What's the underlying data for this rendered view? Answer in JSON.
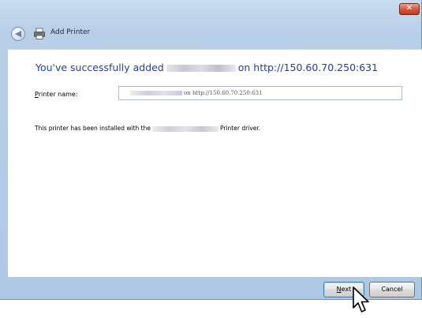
{
  "window": {
    "title": "Add Printer",
    "close_label": "✕",
    "back_glyph": "◀"
  },
  "content": {
    "headline_prefix": "You've successfully added",
    "headline_suffix": "on http://150.60.70.250:631",
    "printer_name_label_accel": "P",
    "printer_name_label_rest": "rinter name:",
    "printer_name_value_suffix": "on http://150.60.70.250:631",
    "driver_prefix": "This printer has been installed with the",
    "driver_suffix": "Printer driver."
  },
  "footer": {
    "next_accel": "N",
    "next_rest": "ext",
    "cancel_label": "Cancel"
  },
  "icons": [
    "back-arrow-icon",
    "printer-icon",
    "close-icon",
    "mouse-cursor-icon"
  ],
  "colors": {
    "headline": "#1f3fa8",
    "title_bar": "#b8cfe8",
    "close_button": "#c2391c"
  }
}
